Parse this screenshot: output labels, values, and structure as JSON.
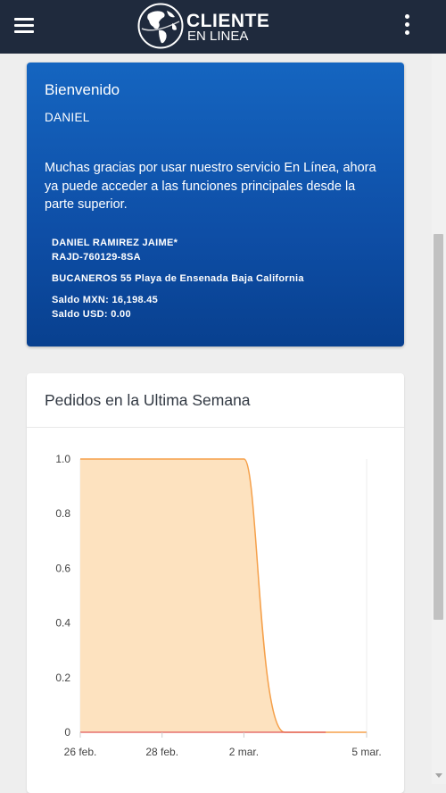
{
  "header": {
    "logo_line1": "CLIENTE",
    "logo_line2": "EN LINEA",
    "menu_icon": "hamburger-icon",
    "more_icon": "kebab-vertical-icon",
    "background_color": "#1f2a3d"
  },
  "welcome": {
    "title": "Bienvenido",
    "name": "DANIEL",
    "message": "Muchas gracias por usar nuestro servicio En Línea, ahora ya puede acceder a las funciones principales desde la parte superior.",
    "full_name": "DANIEL RAMIREZ JAIME*",
    "rfc": "RAJD-760129-8SA",
    "address": "BUCANEROS 55 Playa de Ensenada Baja California",
    "balance_mxn": "Saldo MXN: 16,198.45",
    "balance_usd": "Saldo USD: 0.00",
    "background_color": "#1565c0"
  },
  "chart_card": {
    "title": "Pedidos en la Ultima Semana"
  },
  "chart_data": {
    "type": "area",
    "x_tick_labels": [
      "26 feb.",
      "28 feb.",
      "2 mar.",
      "5 mar."
    ],
    "y_tick_labels": [
      "0",
      "0.2",
      "0.4",
      "0.6",
      "0.8",
      "1.0"
    ],
    "ylim": [
      0,
      1
    ],
    "grid": true,
    "series": [
      {
        "color": "#f5a04a",
        "fill": "#fde2bf",
        "points": [
          {
            "x": "26 feb.",
            "y": 1.0
          },
          {
            "x": "27 feb.",
            "y": 1.0
          },
          {
            "x": "28 feb.",
            "y": 1.0
          },
          {
            "x": "1 mar.",
            "y": 1.0
          },
          {
            "x": "2 mar.",
            "y": 1.0
          },
          {
            "x": "3 mar.",
            "y": 0
          },
          {
            "x": "4 mar.",
            "y": 0
          },
          {
            "x": "5 mar.",
            "y": 0
          }
        ]
      },
      {
        "color": "#e05555",
        "points": [
          {
            "x": "26 feb.",
            "y": 0
          },
          {
            "x": "27 feb.",
            "y": 0
          },
          {
            "x": "28 feb.",
            "y": 0
          },
          {
            "x": "1 mar.",
            "y": 0
          },
          {
            "x": "2 mar.",
            "y": 0
          },
          {
            "x": "3 mar.",
            "y": 0
          },
          {
            "x": "4 mar.",
            "y": 0
          }
        ]
      }
    ]
  }
}
